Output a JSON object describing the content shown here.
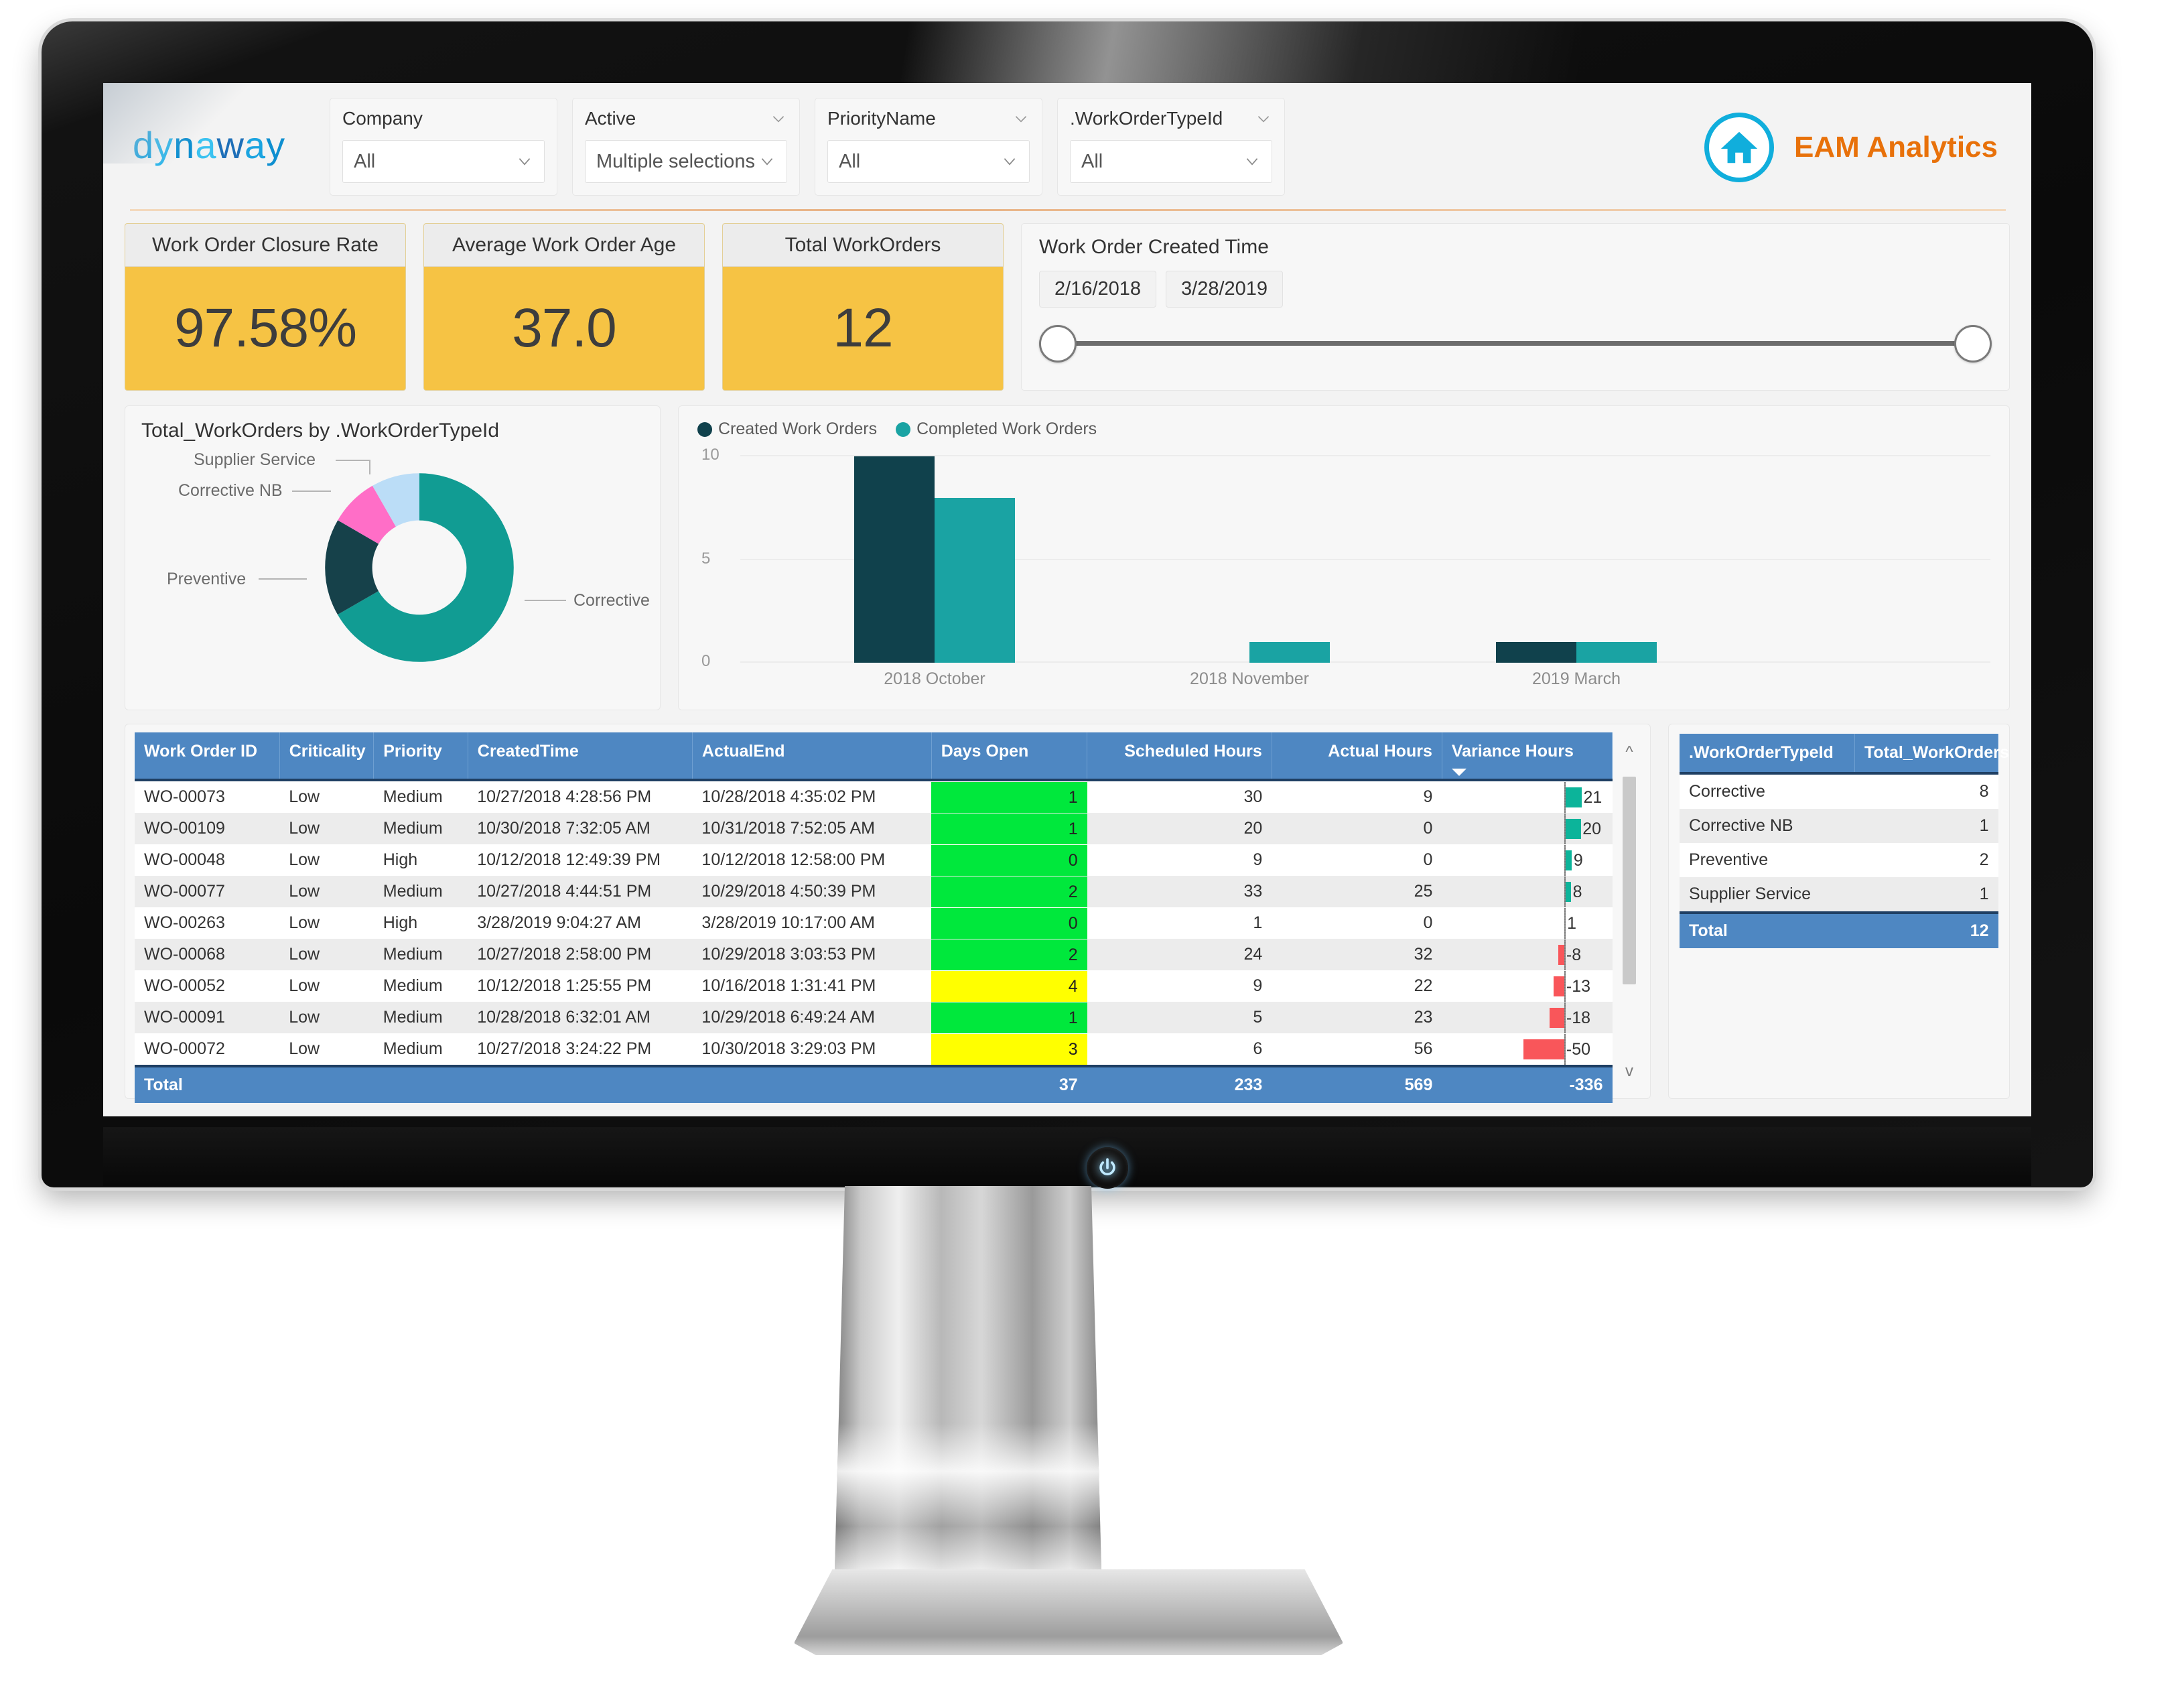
{
  "brand": {
    "logo_text": "dynaway",
    "app_title": "EAM Analytics",
    "home_icon": "home-icon"
  },
  "slicers": [
    {
      "title": "Company",
      "value": "All",
      "has_head_chevron": false
    },
    {
      "title": "Active",
      "value": "Multiple selections",
      "has_head_chevron": true
    },
    {
      "title": "PriorityName",
      "value": "All",
      "has_head_chevron": true
    },
    {
      "title": ".WorkOrderTypeId",
      "value": "All",
      "has_head_chevron": true
    }
  ],
  "kpis": [
    {
      "title": "Work Order Closure Rate",
      "value": "97.58%"
    },
    {
      "title": "Average Work Order Age",
      "value": "37.0"
    },
    {
      "title": "Total WorkOrders",
      "value": "12"
    }
  ],
  "date_range": {
    "title": "Work Order Created Time",
    "start": "2/16/2018",
    "end": "3/28/2019"
  },
  "chart_data": [
    {
      "type": "pie",
      "title": "Total_WorkOrders by .WorkOrderTypeId",
      "categories": [
        "Corrective",
        "Preventive",
        "Corrective NB",
        "Supplier Service"
      ],
      "values": [
        8,
        2,
        1,
        1
      ],
      "colors": [
        "#119C93",
        "#16414A",
        "#FF6EC7",
        "#BBDDF7"
      ],
      "total": 12,
      "legend": "labels-with-leader-lines"
    },
    {
      "type": "bar",
      "title": "",
      "categories": [
        "2018 October",
        "2018 November",
        "2019 March"
      ],
      "series": [
        {
          "name": "Created Work Orders",
          "values": [
            10,
            0,
            1
          ],
          "color": "#10414C"
        },
        {
          "name": "Completed Work Orders",
          "values": [
            8,
            1,
            1
          ],
          "color": "#1AA3A3"
        }
      ],
      "ylabel": "",
      "xlabel": "",
      "ylim": [
        0,
        10
      ],
      "yticks": [
        0,
        5,
        10
      ],
      "grid": true,
      "legend_position": "top-left"
    }
  ],
  "main_table": {
    "columns": [
      "Work Order ID",
      "Criticality",
      "Priority",
      "CreatedTime",
      "ActualEnd",
      "Days Open",
      "Scheduled Hours",
      "Actual Hours",
      "Variance Hours"
    ],
    "sorted_column": "Variance Hours",
    "sort_direction": "descending",
    "rows": [
      {
        "id": "WO-00073",
        "criticality": "Low",
        "priority": "Medium",
        "created": "10/27/2018 4:28:56 PM",
        "end": "10/28/2018 4:35:02 PM",
        "days_open": "1",
        "days_color": "#00E83C",
        "sched": "30",
        "actual": "9",
        "variance": "21"
      },
      {
        "id": "WO-00109",
        "criticality": "Low",
        "priority": "Medium",
        "created": "10/30/2018 7:32:05 AM",
        "end": "10/31/2018 7:52:05 AM",
        "days_open": "1",
        "days_color": "#00E83C",
        "sched": "20",
        "actual": "0",
        "variance": "20"
      },
      {
        "id": "WO-00048",
        "criticality": "Low",
        "priority": "High",
        "created": "10/12/2018 12:49:39 PM",
        "end": "10/12/2018 12:58:00 PM",
        "days_open": "0",
        "days_color": "#00E83C",
        "sched": "9",
        "actual": "0",
        "variance": "9"
      },
      {
        "id": "WO-00077",
        "criticality": "Low",
        "priority": "Medium",
        "created": "10/27/2018 4:44:51 PM",
        "end": "10/29/2018 4:50:39 PM",
        "days_open": "2",
        "days_color": "#00E83C",
        "sched": "33",
        "actual": "25",
        "variance": "8"
      },
      {
        "id": "WO-00263",
        "criticality": "Low",
        "priority": "High",
        "created": "3/28/2019 9:04:27 AM",
        "end": "3/28/2019 10:17:00 AM",
        "days_open": "0",
        "days_color": "#00E83C",
        "sched": "1",
        "actual": "0",
        "variance": "1"
      },
      {
        "id": "WO-00068",
        "criticality": "Low",
        "priority": "Medium",
        "created": "10/27/2018 2:58:00 PM",
        "end": "10/29/2018 3:03:53 PM",
        "days_open": "2",
        "days_color": "#00E83C",
        "sched": "24",
        "actual": "32",
        "variance": "-8"
      },
      {
        "id": "WO-00052",
        "criticality": "Low",
        "priority": "Medium",
        "created": "10/12/2018 1:25:55 PM",
        "end": "10/16/2018 1:31:41 PM",
        "days_open": "4",
        "days_color": "#FFFF00",
        "sched": "9",
        "actual": "22",
        "variance": "-13"
      },
      {
        "id": "WO-00091",
        "criticality": "Low",
        "priority": "Medium",
        "created": "10/28/2018 6:32:01 AM",
        "end": "10/29/2018 6:49:24 AM",
        "days_open": "1",
        "days_color": "#00E83C",
        "sched": "5",
        "actual": "23",
        "variance": "-18"
      },
      {
        "id": "WO-00072",
        "criticality": "Low",
        "priority": "Medium",
        "created": "10/27/2018 3:24:22 PM",
        "end": "10/30/2018 3:29:03 PM",
        "days_open": "3",
        "days_color": "#FFFF00",
        "sched": "6",
        "actual": "56",
        "variance": "-50"
      }
    ],
    "total_row": {
      "label": "Total",
      "days_open": "37",
      "sched": "233",
      "actual": "569",
      "variance": "-336"
    },
    "variance_positive_color": "#0CB49A",
    "variance_negative_color": "#F9565A"
  },
  "side_table": {
    "columns": [
      ".WorkOrderTypeId",
      "Total_WorkOrders"
    ],
    "rows": [
      {
        "type": "Corrective",
        "count": "8"
      },
      {
        "type": "Corrective NB",
        "count": "1"
      },
      {
        "type": "Preventive",
        "count": "2"
      },
      {
        "type": "Supplier Service",
        "count": "1"
      }
    ],
    "total_row": {
      "label": "Total",
      "count": "12"
    }
  }
}
